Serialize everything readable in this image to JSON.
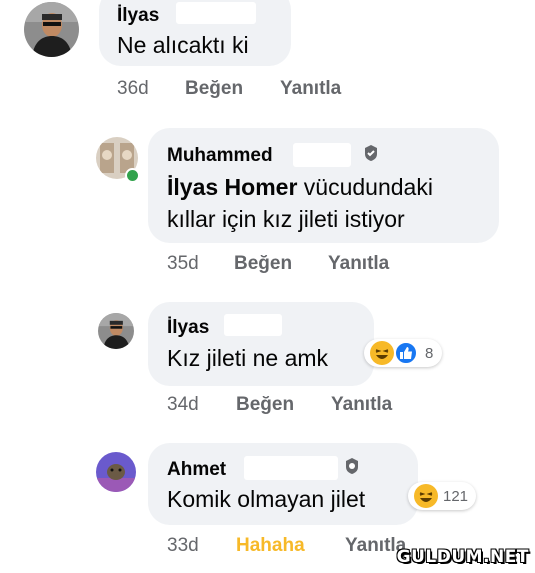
{
  "comments": [
    {
      "author": "İlyas",
      "text": "Ne alıcaktı ki",
      "time": "36d",
      "like_label": "Beğen",
      "reply_label": "Yanıtla"
    },
    {
      "author": "Muhammed",
      "text_bold": "İlyas Homer",
      "text_rest": " vücudundaki",
      "text_line2": "kıllar için kız jileti istiyor",
      "time": "35d",
      "like_label": "Beğen",
      "reply_label": "Yanıtla"
    },
    {
      "author": "İlyas",
      "text": "Kız jileti ne amk",
      "time": "34d",
      "like_label": "Beğen",
      "reply_label": "Yanıtla",
      "reaction_count": "8"
    },
    {
      "author": "Ahmet",
      "text": "Komik olmayan jilet",
      "time": "33d",
      "like_label": "Hahaha",
      "reply_label": "Yanıtla",
      "reaction_count": "121"
    }
  ],
  "watermark": "GULDUM.NET",
  "colors": {
    "bubble": "#f0f2f5",
    "meta": "#65676b",
    "haha_active": "#f7b928",
    "like_blue": "#1877f2",
    "online": "#31a24c"
  }
}
